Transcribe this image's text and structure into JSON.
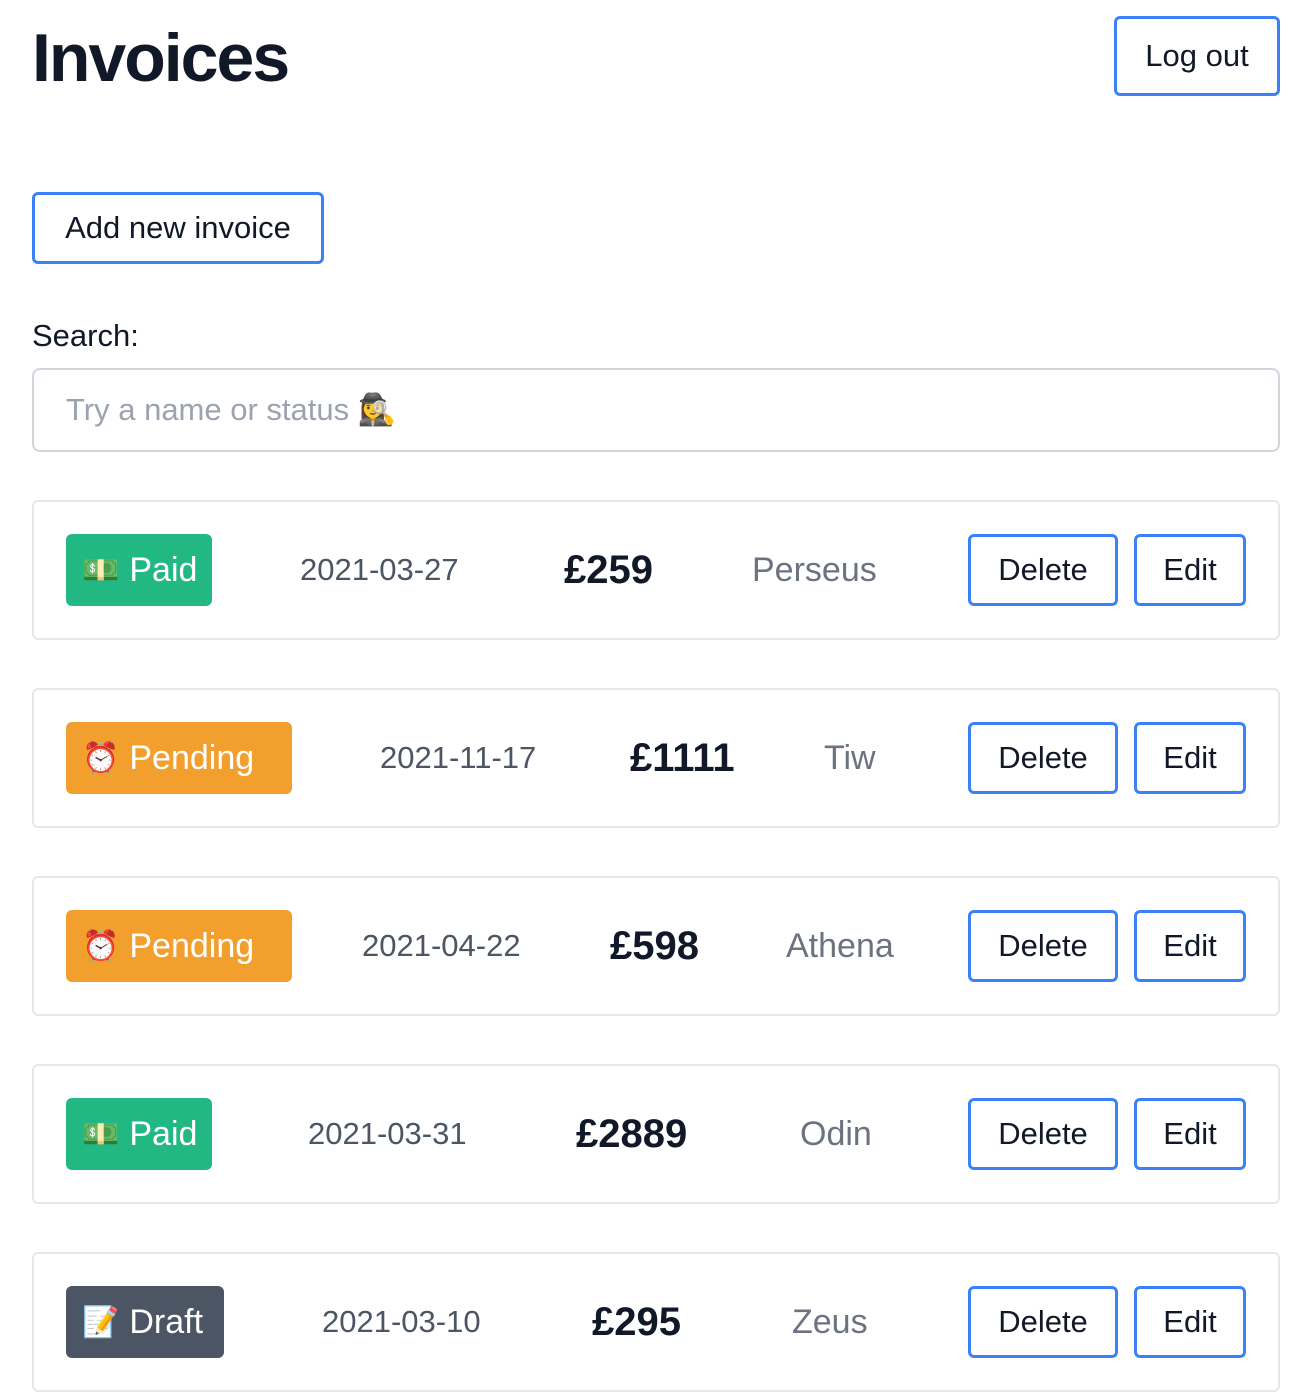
{
  "header": {
    "title": "Invoices",
    "logout_label": "Log out"
  },
  "actions": {
    "add_label": "Add new invoice"
  },
  "search": {
    "label": "Search:",
    "placeholder": "Try a name or status 🕵️‍♀️",
    "value": ""
  },
  "invoices": [
    {
      "status_icon": "💵",
      "status": "Paid",
      "date": "2021-03-27",
      "amount": "£259",
      "client": "Perseus",
      "delete_label": "Delete",
      "edit_label": "Edit"
    },
    {
      "status_icon": "⏰",
      "status": "Pending",
      "date": "2021-11-17",
      "amount": "£1111",
      "client": "Tiw",
      "delete_label": "Delete",
      "edit_label": "Edit"
    },
    {
      "status_icon": "⏰",
      "status": "Pending",
      "date": "2021-04-22",
      "amount": "£598",
      "client": "Athena",
      "delete_label": "Delete",
      "edit_label": "Edit"
    },
    {
      "status_icon": "💵",
      "status": "Paid",
      "date": "2021-03-31",
      "amount": "£2889",
      "client": "Odin",
      "delete_label": "Delete",
      "edit_label": "Edit"
    },
    {
      "status_icon": "📝",
      "status": "Draft",
      "date": "2021-03-10",
      "amount": "£295",
      "client": "Zeus",
      "delete_label": "Delete",
      "edit_label": "Edit"
    }
  ],
  "colors": {
    "accent_border": "#3b82f6",
    "paid": "#22b883",
    "pending": "#f29f2e",
    "draft": "#4b5563"
  }
}
